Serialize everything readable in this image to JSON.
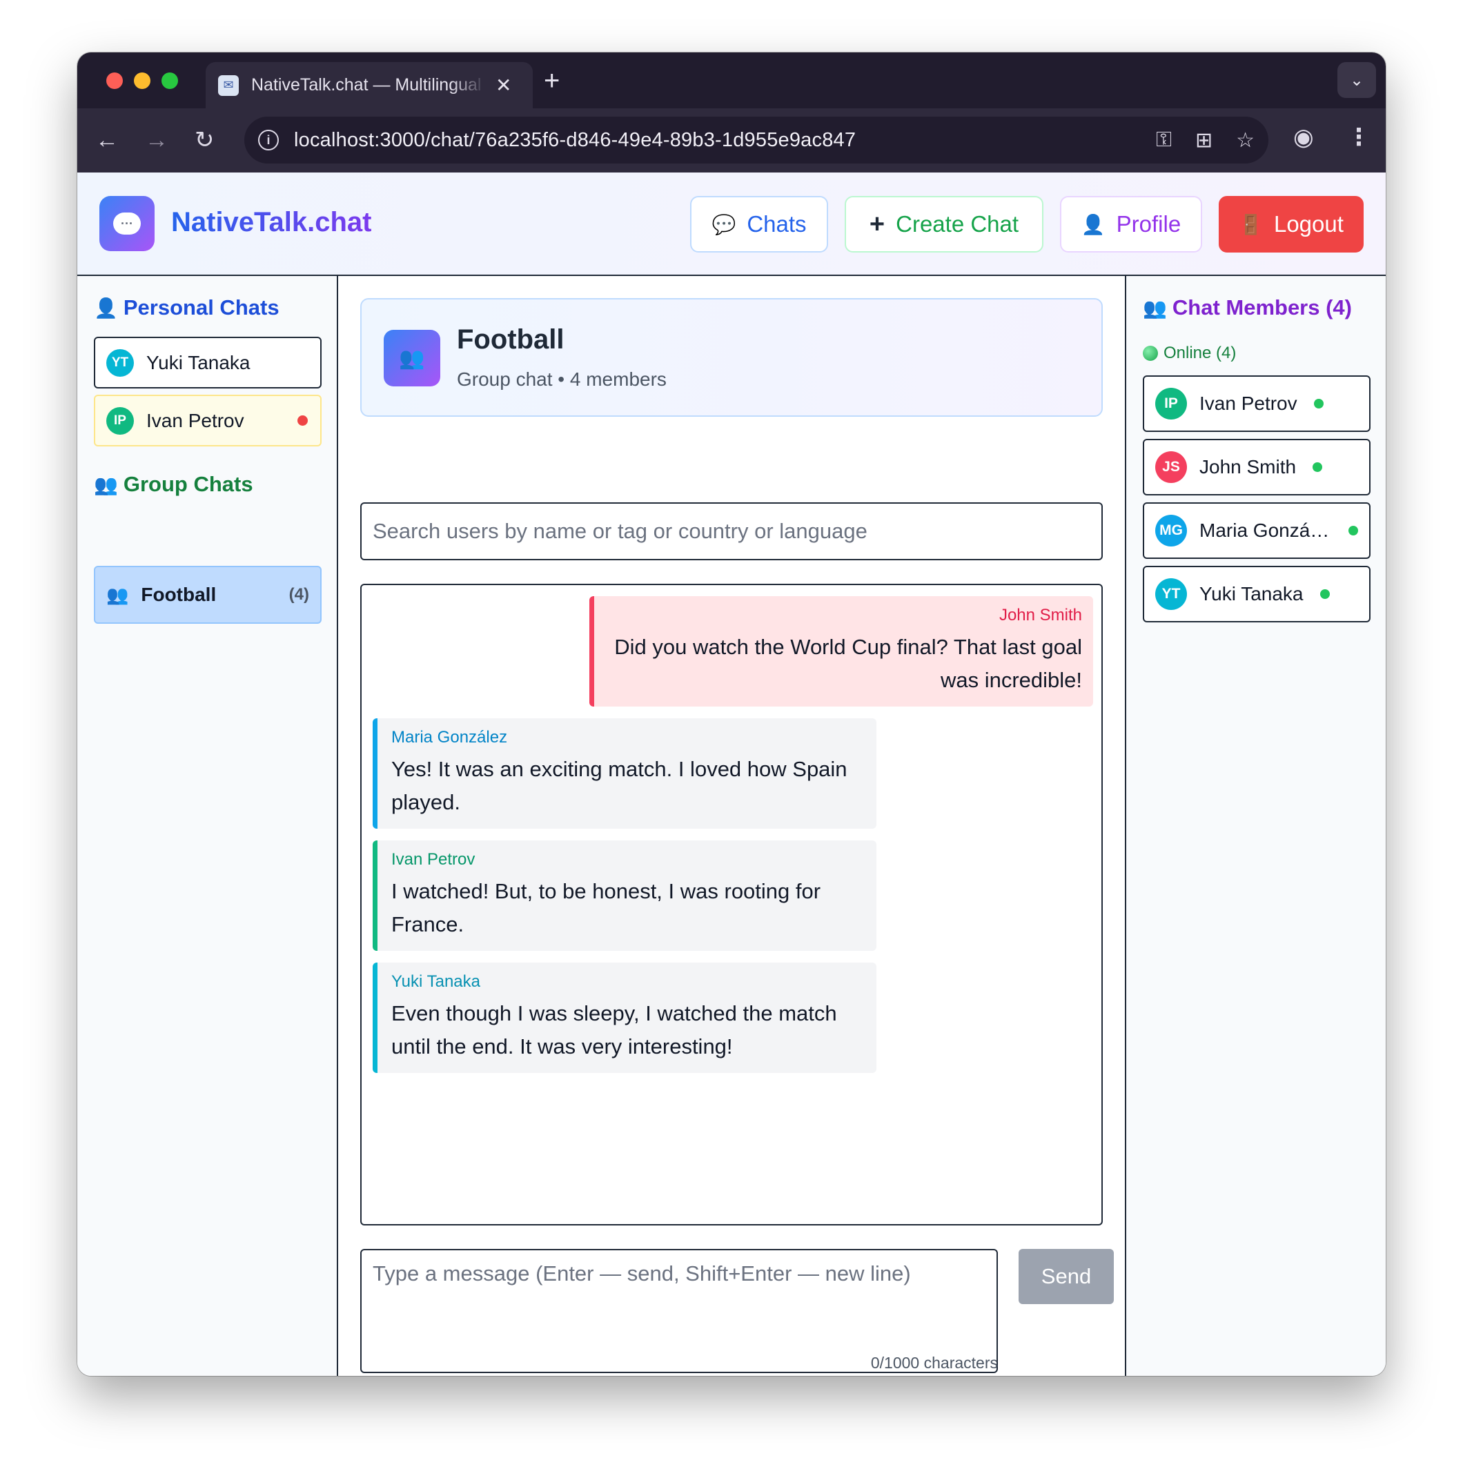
{
  "browser": {
    "tab_title": "NativeTalk.chat — Multilingual",
    "url": "localhost:3000/chat/76a235f6-d846-49e4-89b3-1d955e9ac847"
  },
  "header": {
    "brand": "NativeTalk.chat",
    "chats_label": "Chats",
    "create_label": "Create Chat",
    "profile_label": "Profile",
    "logout_label": "Logout"
  },
  "sidebar": {
    "personal_title": "Personal Chats",
    "personal_chats": [
      {
        "initials": "YT",
        "name": "Yuki Tanaka"
      },
      {
        "initials": "IP",
        "name": "Ivan Petrov"
      }
    ],
    "group_title": "Group Chats",
    "group_chats": [
      {
        "name": "Football",
        "count": "(4)"
      }
    ]
  },
  "chat": {
    "title": "Football",
    "subtitle": "Group chat • 4 members",
    "search_placeholder": "Search users by name or tag or country or language",
    "messages": [
      {
        "sender": "John Smith",
        "text": "Did you watch the World Cup final? That last goal was incredible!"
      },
      {
        "sender": "Maria González",
        "text": "Yes! It was an exciting match. I loved how Spain played."
      },
      {
        "sender": "Ivan Petrov",
        "text": "I watched! But, to be honest, I was rooting for France."
      },
      {
        "sender": "Yuki Tanaka",
        "text": "Even though I was sleepy, I watched the match until the end. It was very interesting!"
      }
    ],
    "compose_placeholder": "Type a message (Enter — send, Shift+Enter — new line)",
    "send_label": "Send",
    "char_count": "0/1000 characters"
  },
  "members": {
    "title": "Chat Members (4)",
    "online_label": "Online (4)",
    "list": [
      {
        "initials": "IP",
        "name": "Ivan Petrov"
      },
      {
        "initials": "JS",
        "name": "John Smith"
      },
      {
        "initials": "MG",
        "name": "Maria González"
      },
      {
        "initials": "YT",
        "name": "Yuki Tanaka"
      }
    ]
  },
  "colors": {
    "accent_blue": "#2563eb",
    "accent_green": "#16a34a",
    "accent_purple": "#9333ea",
    "logout_red": "#ef4444",
    "online_green": "#22c55e"
  }
}
